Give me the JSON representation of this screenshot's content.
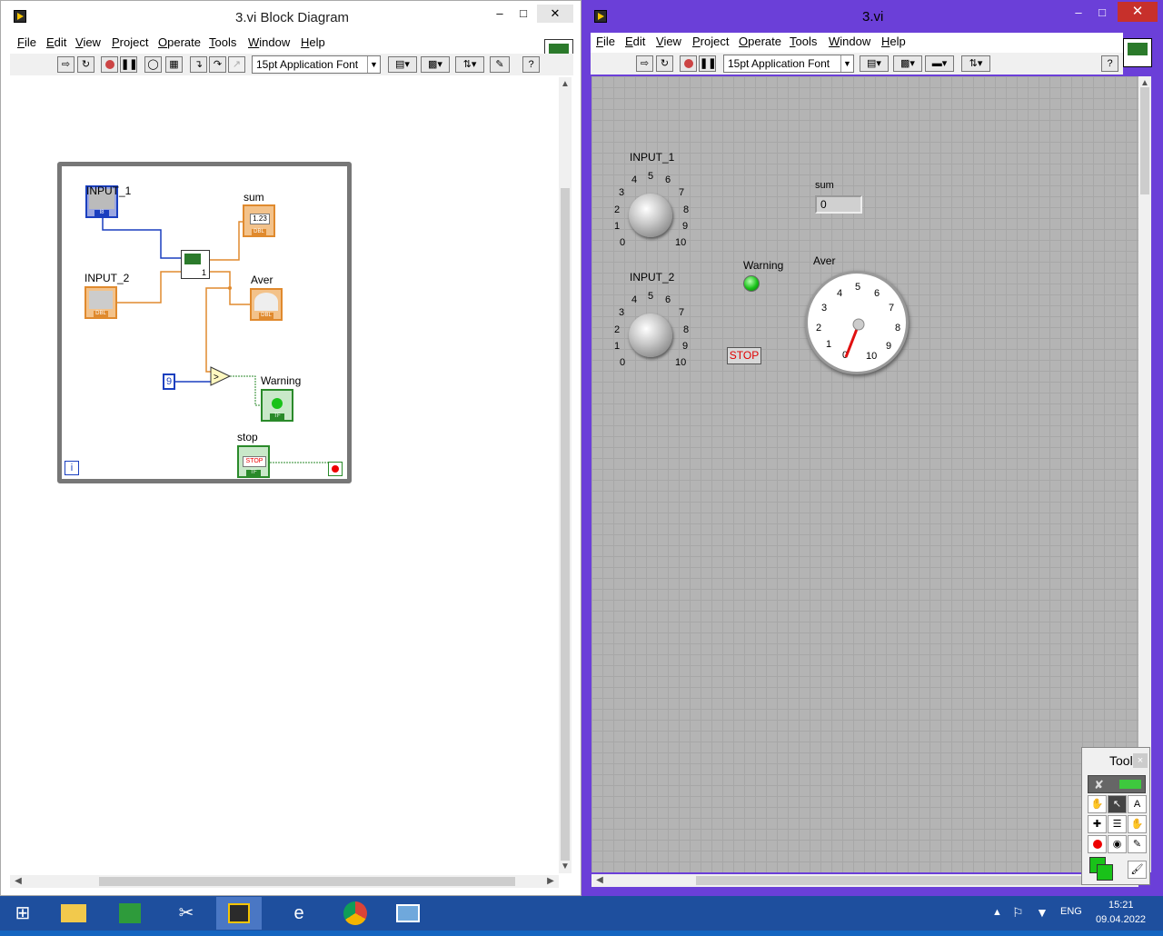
{
  "block_diagram": {
    "title": "3.vi Block Diagram",
    "menu": [
      "File",
      "Edit",
      "View",
      "Project",
      "Operate",
      "Tools",
      "Window",
      "Help"
    ],
    "font": "15pt Application Font",
    "labels": {
      "input1": "INPUT_1",
      "input2": "INPUT_2",
      "sum": "sum",
      "aver": "Aver",
      "warning": "Warning",
      "stop": "stop",
      "constant": "9",
      "iter": "i"
    },
    "terminal_types": {
      "sum_display": "1.23",
      "sum": "DBL",
      "aver": "DBL",
      "input2": "DBL",
      "input1": "I8",
      "warning": "TF",
      "stop": "TF",
      "stop_text": "STOP",
      "subvi_count": "1"
    }
  },
  "front_panel": {
    "title": "3.vi",
    "menu": [
      "File",
      "Edit",
      "View",
      "Project",
      "Operate",
      "Tools",
      "Window",
      "Help"
    ],
    "font": "15pt Application Font",
    "input1": {
      "label": "INPUT_1",
      "ticks": [
        "0",
        "1",
        "2",
        "3",
        "4",
        "5",
        "6",
        "7",
        "8",
        "9",
        "10"
      ]
    },
    "input2": {
      "label": "INPUT_2",
      "ticks": [
        "0",
        "1",
        "2",
        "3",
        "4",
        "5",
        "6",
        "7",
        "8",
        "9",
        "10"
      ]
    },
    "sum": {
      "label": "sum",
      "value": "0"
    },
    "warning": {
      "label": "Warning",
      "state": true
    },
    "stop": {
      "label": "STOP"
    },
    "aver": {
      "label": "Aver",
      "ticks": [
        "0",
        "1",
        "2",
        "3",
        "4",
        "5",
        "6",
        "7",
        "8",
        "9",
        "10"
      ],
      "value": 0
    }
  },
  "tools_palette": {
    "title": "Tools",
    "close": "×"
  },
  "taskbar": {
    "lang": "ENG",
    "time": "15:21",
    "date": "09.04.2022"
  },
  "colors": {
    "fp_frame": "#6b3fd8",
    "taskbar": "#1e4f9e",
    "led_on": "#19c219",
    "wire_orange": "#e08a2e",
    "wire_blue": "#1a3fbf",
    "wire_green": "#2a8a2a"
  }
}
